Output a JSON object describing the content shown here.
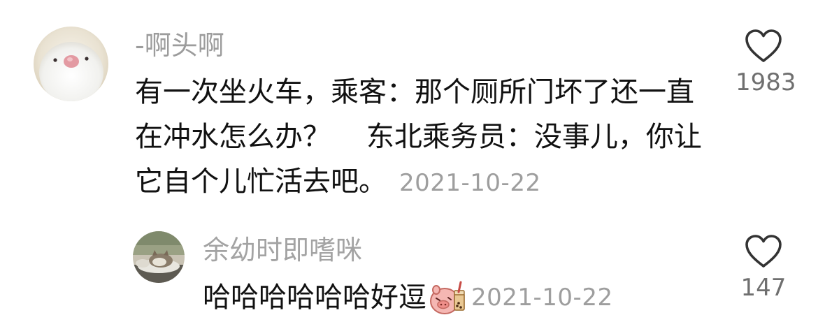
{
  "comment": {
    "username": "-啊头啊",
    "text": "有一次坐火车，乘客：那个厕所门坏了还一直在冲水怎么办？    东北乘务员：没事儿，你让它自个儿忙活去吧。",
    "timestamp": "2021-10-22",
    "like_count": "1983",
    "avatar_icon": "bird-avatar-icon",
    "like_icon": "heart-outline-icon"
  },
  "reply": {
    "username": "余幼时即嗜咪",
    "text": "哈哈哈哈哈哈好逗",
    "sticker_icon": "pig-bubble-tea-sticker-icon",
    "timestamp": "2021-10-22",
    "like_count": "147",
    "avatar_icon": "cat-avatar-icon",
    "like_icon": "heart-outline-icon"
  },
  "colors": {
    "username": "#9c9c9c",
    "text": "#111111",
    "timestamp": "#9e9e9e",
    "like_count": "#6f6f6f"
  }
}
